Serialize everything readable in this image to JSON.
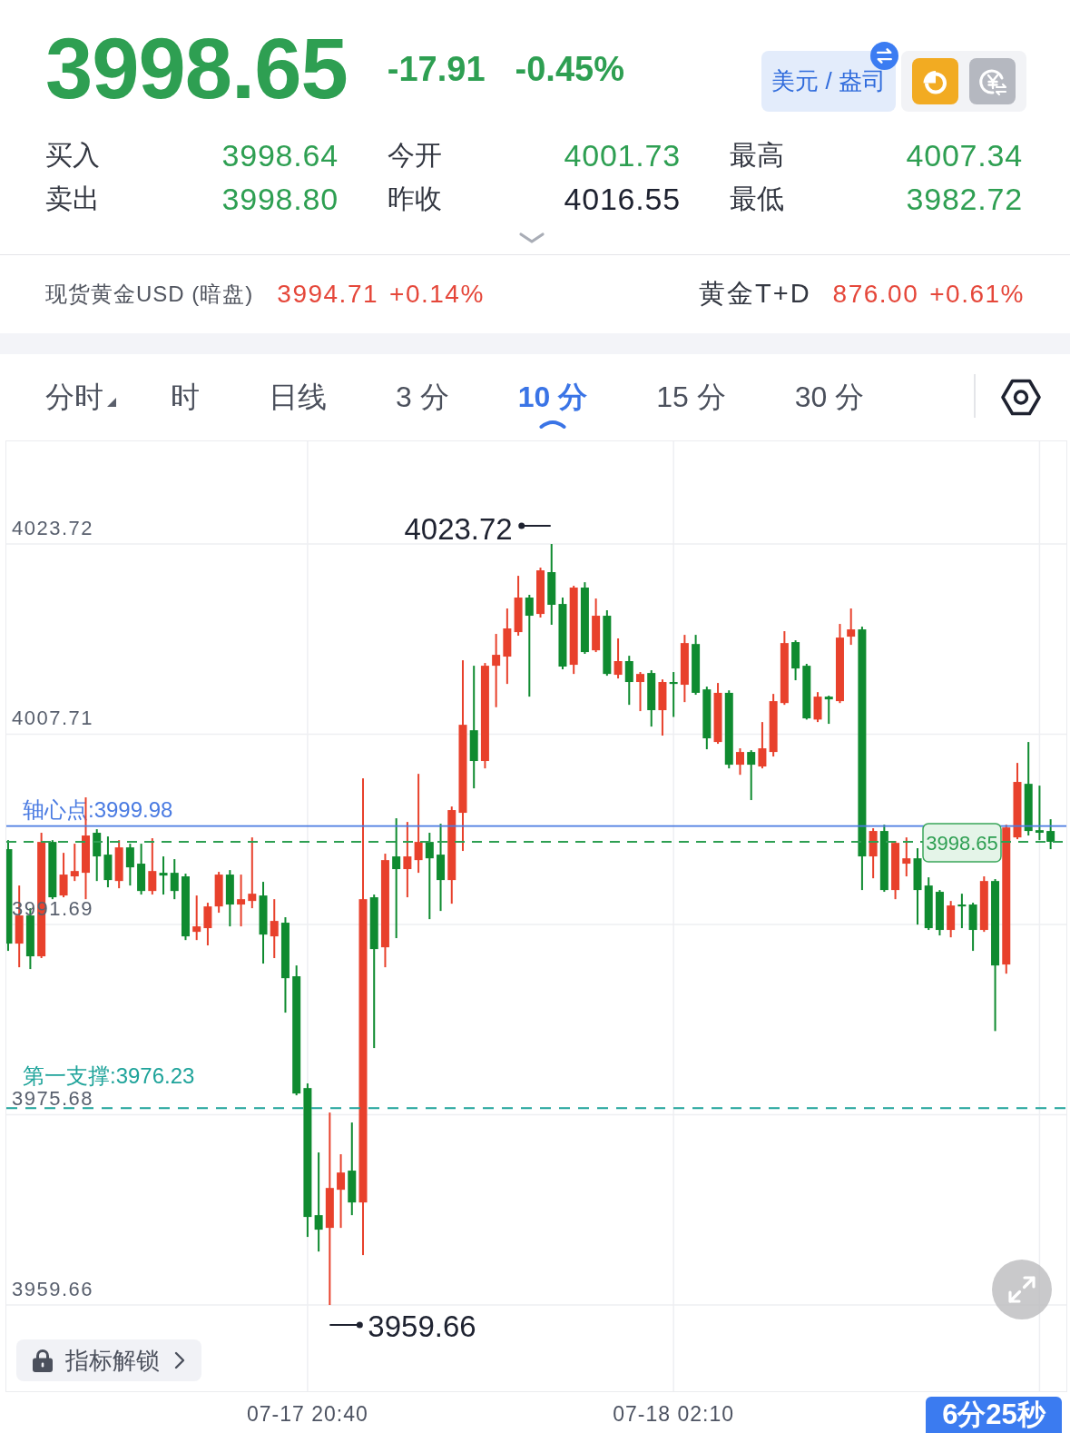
{
  "quote": {
    "price": "3998.65",
    "change": "-17.91",
    "change_percent": "-0.45%",
    "color": "#2e9f52"
  },
  "unit_button": {
    "label": "美元 / 盎司"
  },
  "stats": [
    {
      "label": "买入",
      "value": "3998.64",
      "color": "#2e9f52"
    },
    {
      "label": "今开",
      "value": "4001.73",
      "color": "#2e9f52"
    },
    {
      "label": "最高",
      "value": "4007.34",
      "color": "#2e9f52"
    },
    {
      "label": "卖出",
      "value": "3998.80",
      "color": "#2e9f52"
    },
    {
      "label": "昨收",
      "value": "4016.55",
      "color": "#1e2230"
    },
    {
      "label": "最低",
      "value": "3982.72",
      "color": "#2e9f52"
    }
  ],
  "related_quotes": [
    {
      "name": "现货黄金USD (暗盘)",
      "price": "3994.71",
      "change": "+0.14%",
      "color": "#e5473a"
    },
    {
      "name": "黄金T+D",
      "price": "876.00",
      "change": "+0.61%",
      "color": "#e5473a"
    }
  ],
  "period_tabs": [
    {
      "label": "分时",
      "kind": "dropdown",
      "selected": false
    },
    {
      "label": "时",
      "kind": "plain",
      "selected": false
    },
    {
      "label": "日线",
      "kind": "plain",
      "selected": false
    },
    {
      "label": "3 分",
      "kind": "plain",
      "selected": false
    },
    {
      "label": "10 分",
      "kind": "plain",
      "selected": true
    },
    {
      "label": "15 分",
      "kind": "plain",
      "selected": false
    },
    {
      "label": "30 分",
      "kind": "plain",
      "selected": false
    }
  ],
  "chart": {
    "chart_data": {
      "type": "candlestick",
      "categories": [
        null,
        null,
        null,
        null,
        null,
        null,
        null,
        null,
        null,
        null,
        null,
        null,
        null,
        null,
        null,
        null,
        null,
        null,
        null,
        null,
        null,
        null,
        null,
        null,
        null,
        null,
        null,
        "07-17 20:40",
        null,
        null,
        null,
        null,
        null,
        null,
        null,
        null,
        null,
        null,
        null,
        null,
        null,
        null,
        null,
        null,
        null,
        null,
        null,
        null,
        null,
        null,
        null,
        null,
        null,
        null,
        null,
        null,
        null,
        null,
        null,
        null,
        "07-18 02:10",
        null,
        null,
        null,
        null,
        null,
        null,
        null,
        null,
        null,
        null,
        null,
        null,
        null,
        null,
        null,
        null,
        null,
        null,
        null,
        null,
        null,
        null,
        null,
        null,
        null,
        null,
        null,
        null,
        null,
        null,
        null,
        null,
        null,
        null
      ],
      "ohlc": [
        [
          3998.03,
          3998.79,
          3989.47,
          3990.08
        ],
        [
          3990.08,
          3994.97,
          3988.09,
          3992.45
        ],
        [
          3992.45,
          3993.06,
          3987.94,
          3989.01
        ],
        [
          3989.01,
          3999.41,
          3988.86,
          3998.64
        ],
        [
          3998.64,
          3998.79,
          3993.82,
          3993.98
        ],
        [
          3994.13,
          3997.72,
          3993.98,
          3995.89
        ],
        [
          3995.74,
          3998.49,
          3995.35,
          3996.19
        ],
        [
          3996.04,
          4002.39,
          3993.82,
          3999.18
        ],
        [
          3999.41,
          3999.71,
          3995.35,
          3997.42
        ],
        [
          3997.57,
          3999.1,
          3994.82,
          3995.43
        ],
        [
          3995.35,
          3998.79,
          3994.74,
          3998.18
        ],
        [
          3998.18,
          3998.49,
          3994.97,
          3996.5
        ],
        [
          3996.81,
          3998.49,
          3994.21,
          3994.51
        ],
        [
          3994.51,
          3998.95,
          3994.21,
          3996.19
        ],
        [
          3996.04,
          3997.42,
          3994.21,
          3995.81
        ],
        [
          3996.04,
          3997.19,
          3993.82,
          3994.51
        ],
        [
          3995.74,
          3995.97,
          3990.38,
          3990.69
        ],
        [
          3991.07,
          3994.13,
          3990.38,
          3991.53
        ],
        [
          3991.38,
          3993.52,
          3989.93,
          3993.21
        ],
        [
          3993.21,
          3996.12,
          3992.68,
          3995.89
        ],
        [
          3995.89,
          3996.27,
          3991.53,
          3993.37
        ],
        [
          3993.37,
          3995.89,
          3991.53,
          3993.82
        ],
        [
          3993.67,
          3999.02,
          3993.06,
          3994.28
        ],
        [
          3994.13,
          3995.28,
          3988.4,
          3990.84
        ],
        [
          3990.69,
          3993.82,
          3988.86,
          3991.99
        ],
        [
          3991.84,
          3992.3,
          3984.27,
          3987.17
        ],
        [
          3987.33,
          3988.24,
          3977.31,
          3977.46
        ],
        [
          3977.92,
          3978.31,
          3965.39,
          3967.07
        ],
        [
          3967.22,
          3972.5,
          3964.16,
          3966.0
        ],
        [
          3966.15,
          3975.86,
          3959.66,
          3969.51
        ],
        [
          3969.36,
          3972.35,
          3966.15,
          3970.81
        ],
        [
          3970.97,
          3975.02,
          3967.22,
          3968.29
        ],
        [
          3968.29,
          4003.99,
          3963.86,
          3993.82
        ],
        [
          3993.98,
          3994.21,
          3981.29,
          3989.62
        ],
        [
          3989.77,
          3997.65,
          3988.09,
          3997.11
        ],
        [
          3997.42,
          4000.63,
          3990.54,
          3996.35
        ],
        [
          3996.35,
          4000.32,
          3993.98,
          3997.42
        ],
        [
          3997.11,
          4004.37,
          3996.04,
          3998.64
        ],
        [
          3998.64,
          3999.41,
          3992.14,
          3997.26
        ],
        [
          3997.57,
          4000.17,
          3992.83,
          3995.43
        ],
        [
          3995.43,
          4001.62,
          3993.44,
          4001.32
        ],
        [
          4001.09,
          4013.93,
          3997.88,
          4008.5
        ],
        [
          4008.04,
          4013.47,
          4003.15,
          4005.45
        ],
        [
          4005.45,
          4013.7,
          4004.83,
          4013.47
        ],
        [
          4013.47,
          4016.15,
          4009.98,
          4014.39
        ],
        [
          4014.24,
          4018.29,
          4011.94,
          4016.61
        ],
        [
          4016.3,
          4021.04,
          4016.0,
          4019.21
        ],
        [
          4019.21,
          4019.44,
          4010.87,
          4017.68
        ],
        [
          4017.83,
          4021.73,
          4017.53,
          4021.5
        ],
        [
          4021.35,
          4023.72,
          4016.92,
          4018.6
        ],
        [
          4018.67,
          4019.21,
          4013.17,
          4013.4
        ],
        [
          4013.55,
          4020.2,
          4012.78,
          4020.05
        ],
        [
          4020.05,
          4020.5,
          4014.47,
          4014.62
        ],
        [
          4014.77,
          4019.13,
          4014.62,
          4017.68
        ],
        [
          4017.68,
          4018.14,
          4012.63,
          4012.78
        ],
        [
          4012.71,
          4015.77,
          4012.4,
          4013.86
        ],
        [
          4013.86,
          4014.31,
          4010.18,
          4012.1
        ],
        [
          4012.1,
          4012.94,
          4009.65,
          4012.78
        ],
        [
          4012.86,
          4013.09,
          4008.35,
          4009.73
        ],
        [
          4009.73,
          4012.32,
          4007.59,
          4012.1
        ],
        [
          4012.1,
          4012.94,
          4009.16,
          4011.94
        ],
        [
          4011.87,
          4016.07,
          4010.41,
          4015.38
        ],
        [
          4015.3,
          4016.07,
          4011.03,
          4011.19
        ],
        [
          4011.48,
          4011.71,
          4006.44,
          4007.36
        ],
        [
          4007.05,
          4012.02,
          4006.9,
          4011.19
        ],
        [
          4011.19,
          4011.4,
          4004.83,
          4005.14
        ],
        [
          4005.14,
          4006.52,
          4004.29,
          4006.21
        ],
        [
          4006.21,
          4006.36,
          4002.16,
          4005.14
        ],
        [
          4004.99,
          4008.73,
          4004.83,
          4006.52
        ],
        [
          4006.21,
          4011.1,
          4005.83,
          4010.49
        ],
        [
          4010.33,
          4016.38,
          4010.18,
          4015.38
        ],
        [
          4015.46,
          4015.61,
          4012.25,
          4013.24
        ],
        [
          4013.47,
          4013.63,
          4008.94,
          4009.04
        ],
        [
          4008.94,
          4011.25,
          4008.73,
          4010.87
        ],
        [
          4010.87,
          4010.95,
          4008.58,
          4010.64
        ],
        [
          4010.49,
          4016.99,
          4010.33,
          4015.84
        ],
        [
          4015.92,
          4018.29,
          4015.23,
          4016.53
        ],
        [
          4016.53,
          4016.76,
          3994.59,
          3997.42
        ],
        [
          3997.42,
          3999.79,
          3995.58,
          3999.56
        ],
        [
          3999.56,
          4000.09,
          3994.44,
          3994.59
        ],
        [
          3994.59,
          3998.72,
          3993.82,
          3998.56
        ],
        [
          3996.81,
          3999.02,
          3995.74,
          3997.26
        ],
        [
          3997.26,
          3998.11,
          3991.68,
          3994.59
        ],
        [
          3994.97,
          3995.66,
          3991.23,
          3991.38
        ],
        [
          3994.44,
          3994.59,
          3990.77,
          3991.23
        ],
        [
          3991.23,
          3993.67,
          3990.61,
          3993.29
        ],
        [
          3993.37,
          3994.28,
          3991.38,
          3993.21
        ],
        [
          3993.37,
          3993.52,
          3989.47,
          3991.23
        ],
        [
          3991.23,
          3995.74,
          3991.07,
          3995.35
        ],
        [
          3995.35,
          3995.51,
          3982.72,
          3988.24
        ],
        [
          3988.32,
          4000.09,
          3987.55,
          3999.86
        ],
        [
          3999.02,
          4005.29,
          3998.87,
          4003.69
        ],
        [
          4003.53,
          4007.05,
          3999.18,
          3999.56
        ],
        [
          3999.63,
          4003.38,
          3998.79,
          3999.41
        ],
        [
          3999.56,
          4000.55,
          3998.03,
          3998.65
        ]
      ],
      "ylim": [
        3952.4,
        4032.36
      ],
      "grid": true,
      "yticks": [
        {
          "value": 4023.72,
          "label": "4023.72"
        },
        {
          "value": 4007.71,
          "label": "4007.71"
        },
        {
          "value": 3991.69,
          "label": "3991.69"
        },
        {
          "value": 3975.68,
          "label": "3975.68"
        },
        {
          "value": 3959.66,
          "label": "3959.66"
        }
      ],
      "ref_lines": [
        {
          "axis": "y",
          "value": 3999.98,
          "label": "轴心点:3999.98",
          "color": "#4a7be2"
        },
        {
          "axis": "y",
          "value": 3998.65,
          "color": "#2e9f52"
        },
        {
          "axis": "y",
          "value": 3976.23,
          "label": "第一支撑:3976.23",
          "color": "#1ea39a"
        }
      ],
      "annotations": [
        "4023.72",
        "3998.65",
        "3959.66"
      ]
    }
  },
  "indicator_unlock_button": {
    "label": "指标解锁"
  },
  "countdown": "6分25秒"
}
